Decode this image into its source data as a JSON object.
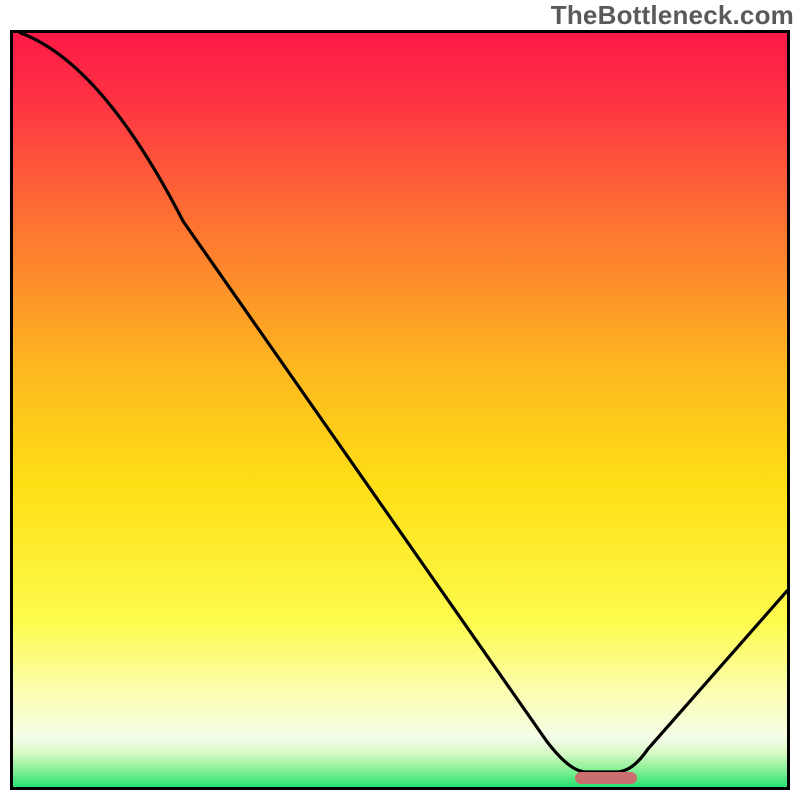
{
  "watermark": "TheBottleneck.com",
  "colors": {
    "top": "#fe1a46",
    "mid_upper": "#fd8b2f",
    "mid": "#fedb17",
    "mid_lower": "#fbfc9a",
    "low_band": "#f6fde0",
    "green": "#28e372",
    "curve": "#000000",
    "marker": "#cb6e6f",
    "border": "#000000"
  },
  "chart_data": {
    "type": "line",
    "title": "",
    "xlabel": "",
    "ylabel": "",
    "xlim": [
      0,
      100
    ],
    "ylim": [
      0,
      100
    ],
    "x": [
      0,
      1,
      22,
      72,
      80,
      100
    ],
    "values": [
      101,
      100,
      75,
      2,
      2,
      26
    ],
    "optimum_band_x": [
      72,
      80
    ],
    "optimum_band_y": 2
  }
}
